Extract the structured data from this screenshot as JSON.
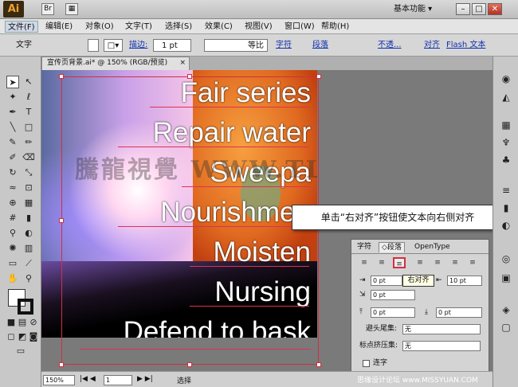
{
  "app": {
    "logo": "Ai",
    "workspace": "基本功能 ▾",
    "window_controls": {
      "minimize": "–",
      "restore": "□",
      "close": "✕"
    }
  },
  "menu": [
    "文件(F)",
    "编辑(E)",
    "对象(O)",
    "文字(T)",
    "选择(S)",
    "效果(C)",
    "视图(V)",
    "窗口(W)",
    "帮助(H)"
  ],
  "control_bar": {
    "label": "文字",
    "stroke_label": "描边:",
    "stroke_value": "1 pt",
    "stroke_style": "等比",
    "char_link": "字符",
    "para_link": "段落",
    "opacity_link": "不透...",
    "align_link": "对齐",
    "flash_link": "Flash 文本"
  },
  "document": {
    "tab_title": "宣传页背景.ai* @ 150% (RGB/预览)",
    "close": "×"
  },
  "artwork": {
    "lines": [
      "Fair series",
      "Repair water",
      "Sweepa",
      "Nourishmen",
      "Moisten",
      "Nursing",
      "Defend to bask"
    ],
    "watermark": "騰龍視覺 WWW.TLVI.NET"
  },
  "callout": "单击“右对齐”按钮使文本向右侧对齐",
  "paragraph_panel": {
    "tabs": [
      "字符",
      "段落",
      "OpenType"
    ],
    "align_buttons": [
      "左对齐",
      "居中对齐",
      "右对齐",
      "两端对齐末行左",
      "两端对齐末行中",
      "两端对齐末行右",
      "全部两端对齐"
    ],
    "tooltip": "右对齐",
    "left_indent": "0 pt",
    "right_indent": "10 pt",
    "first_indent": "0 pt",
    "space_before": "0 pt",
    "space_after": "0 pt",
    "kinsoku_label": "避头尾集:",
    "kinsoku_value": "无",
    "mojikumi_label": "标点挤压集:",
    "mojikumi_value": "无",
    "hyphen_label": "连字"
  },
  "status": {
    "zoom": "150%",
    "page": "1",
    "mode": "选择"
  },
  "credit": "思缘设计论坛 www.MISSYUAN.COM",
  "colors": {
    "accent": "#d03040",
    "callout_border": "#333333"
  }
}
